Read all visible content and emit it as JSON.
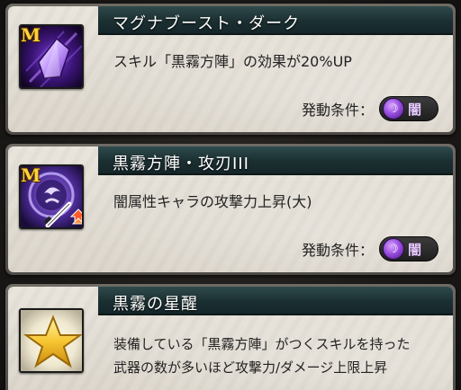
{
  "skills": [
    {
      "name": "マグナブースト・ダーク",
      "has_m_badge": true,
      "m_badge": "M",
      "icon": "purple-crystal-icon",
      "description_lines": [
        "スキル「黒霧方陣」の効果が20%UP"
      ],
      "condition_label": "発動条件：",
      "condition_element": "闇",
      "element_color": "#9b4fe0"
    },
    {
      "name": "黒霧方陣・攻刃III",
      "has_m_badge": true,
      "m_badge": "M",
      "icon": "dark-attack-up-icon",
      "description_lines": [
        "闇属性キャラの攻撃力上昇(大)"
      ],
      "condition_label": "発動条件：",
      "condition_element": "闇",
      "element_color": "#9b4fe0"
    },
    {
      "name": "黒霧の星醒",
      "has_m_badge": false,
      "icon": "gold-star-icon",
      "description_lines": [
        "装備している「黒霧方陣」がつくスキルを持った",
        "武器の数が多いほど攻撃力/ダメージ上限上昇"
      ]
    }
  ]
}
